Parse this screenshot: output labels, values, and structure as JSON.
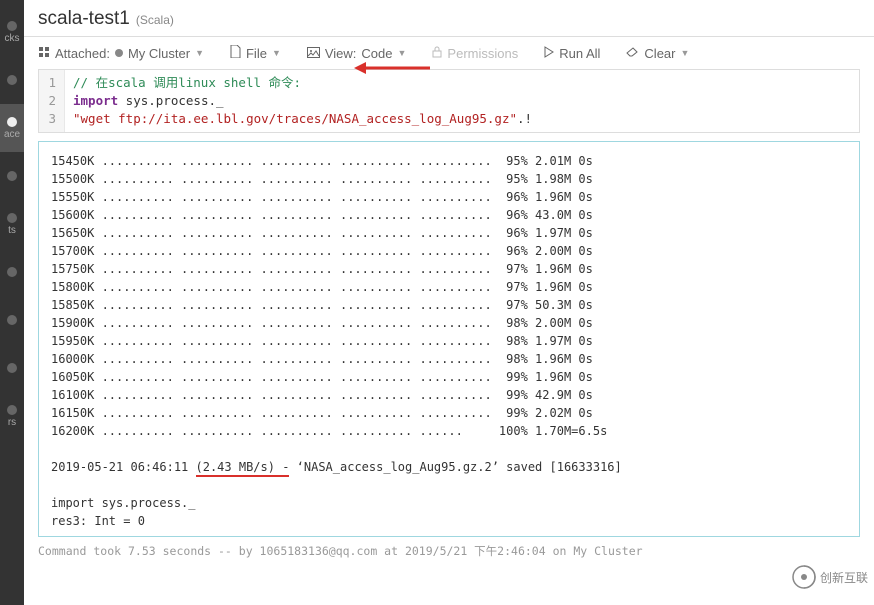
{
  "title": {
    "name": "scala-test1",
    "lang": "(Scala)"
  },
  "left_rail": [
    "cks",
    "",
    "ace",
    "",
    "ts",
    "",
    "",
    "",
    "rs",
    ""
  ],
  "toolbar": {
    "attached_prefix": "Attached:",
    "cluster_label": "My Cluster",
    "file_label": "File",
    "view_prefix": "View:",
    "view_label": "Code",
    "permissions_label": "Permissions",
    "runall_label": "Run All",
    "clear_label": "Clear"
  },
  "code": {
    "lines": [
      {
        "n": "1",
        "html": "<span class='c-comment'>// 在scala 调用linux shell 命令:</span>"
      },
      {
        "n": "2",
        "html": "<span class='c-kw'>import</span> sys.process._"
      },
      {
        "n": "3",
        "html": "<span class='c-str'>\"wget ftp://ita.ee.lbl.gov/traces/NASA_access_log_Aug95.gz\"</span>.!"
      }
    ]
  },
  "output": {
    "progress": [
      {
        "k": "15450K",
        "dots": ".......... .......... .......... .......... ..........",
        "pct": "95%",
        "rate": "2.01M",
        "t": "0s"
      },
      {
        "k": "15500K",
        "dots": ".......... .......... .......... .......... ..........",
        "pct": "95%",
        "rate": "1.98M",
        "t": "0s"
      },
      {
        "k": "15550K",
        "dots": ".......... .......... .......... .......... ..........",
        "pct": "96%",
        "rate": "1.96M",
        "t": "0s"
      },
      {
        "k": "15600K",
        "dots": ".......... .......... .......... .......... ..........",
        "pct": "96%",
        "rate": "43.0M",
        "t": "0s"
      },
      {
        "k": "15650K",
        "dots": ".......... .......... .......... .......... ..........",
        "pct": "96%",
        "rate": "1.97M",
        "t": "0s"
      },
      {
        "k": "15700K",
        "dots": ".......... .......... .......... .......... ..........",
        "pct": "96%",
        "rate": "2.00M",
        "t": "0s"
      },
      {
        "k": "15750K",
        "dots": ".......... .......... .......... .......... ..........",
        "pct": "97%",
        "rate": "1.96M",
        "t": "0s"
      },
      {
        "k": "15800K",
        "dots": ".......... .......... .......... .......... ..........",
        "pct": "97%",
        "rate": "1.96M",
        "t": "0s"
      },
      {
        "k": "15850K",
        "dots": ".......... .......... .......... .......... ..........",
        "pct": "97%",
        "rate": "50.3M",
        "t": "0s"
      },
      {
        "k": "15900K",
        "dots": ".......... .......... .......... .......... ..........",
        "pct": "98%",
        "rate": "2.00M",
        "t": "0s"
      },
      {
        "k": "15950K",
        "dots": ".......... .......... .......... .......... ..........",
        "pct": "98%",
        "rate": "1.97M",
        "t": "0s"
      },
      {
        "k": "16000K",
        "dots": ".......... .......... .......... .......... ..........",
        "pct": "98%",
        "rate": "1.96M",
        "t": "0s"
      },
      {
        "k": "16050K",
        "dots": ".......... .......... .......... .......... ..........",
        "pct": "99%",
        "rate": "1.96M",
        "t": "0s"
      },
      {
        "k": "16100K",
        "dots": ".......... .......... .......... .......... ..........",
        "pct": "99%",
        "rate": "42.9M",
        "t": "0s"
      },
      {
        "k": "16150K",
        "dots": ".......... .......... .......... .......... ..........",
        "pct": "99%",
        "rate": "2.02M",
        "t": "0s"
      },
      {
        "k": "16200K",
        "dots": ".......... .......... .......... .......... ......    ",
        "pct": "100%",
        "rate": "1.70M=6.5s",
        "t": ""
      }
    ],
    "summary_pre": "2019-05-21 06:46:11 ",
    "summary_rate": "(2.43 MB/s) -",
    "summary_post": " ‘NASA_access_log_Aug95.gz.2’ saved [16633316]",
    "trailer": [
      "import sys.process._",
      "res3: Int = 0"
    ]
  },
  "footer": "Command took 7.53 seconds -- by 1065183136@qq.com at 2019/5/21 下午2:46:04 on My Cluster",
  "watermark": "创新互联"
}
